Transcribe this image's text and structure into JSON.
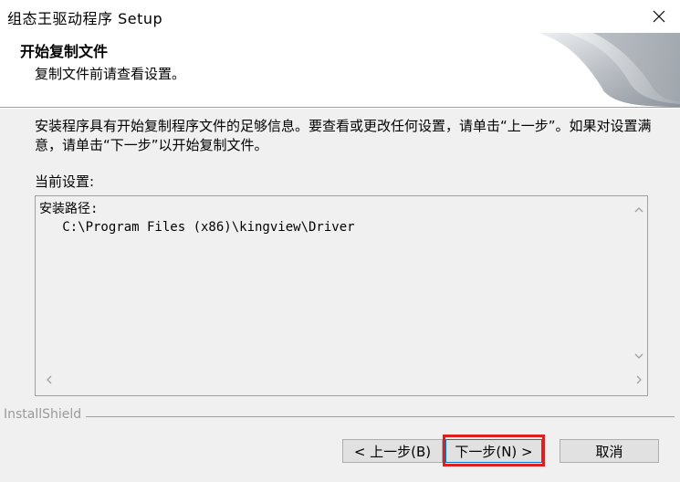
{
  "window": {
    "title": "组态王驱动程序 Setup"
  },
  "header": {
    "title": "开始复制文件",
    "subtitle": "复制文件前请查看设置。"
  },
  "body": {
    "description": "安装程序具有开始复制程序文件的足够信息。要查看或更改任何设置，请单击“上一步”。如果对设置满意，请单击“下一步”以开始复制文件。",
    "settings_label": "当前设置:",
    "settings_lines": {
      "line1": "安装路径:",
      "line2": "   C:\\Program Files (x86)\\kingview\\Driver"
    }
  },
  "footer": {
    "brand": "InstallShield"
  },
  "buttons": {
    "back": "< 上一步(B)",
    "next": "下一步(N) >",
    "cancel": "取消"
  },
  "colors": {
    "highlight": "#e01e1e",
    "focus": "#0078d7"
  }
}
